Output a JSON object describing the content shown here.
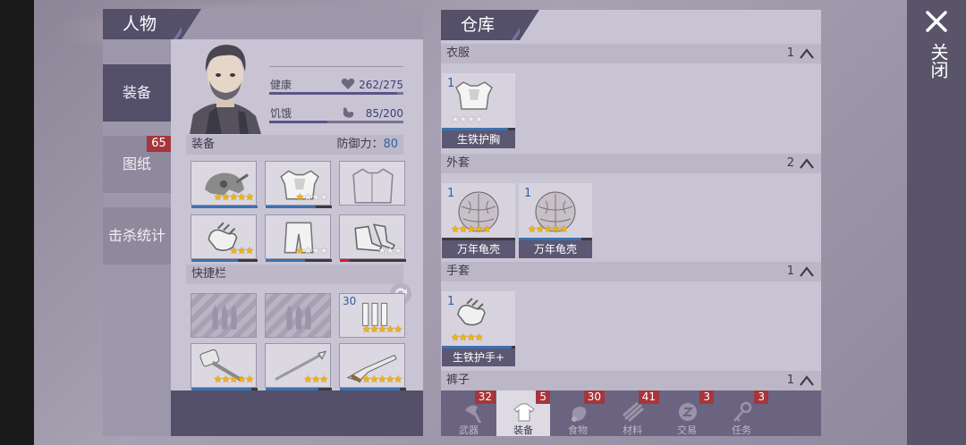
{
  "character": {
    "header": "人物",
    "tabs": [
      {
        "label": "装备",
        "active": true
      },
      {
        "label": "图纸",
        "badge": "65"
      },
      {
        "label": "击杀统计"
      }
    ],
    "stats": {
      "health_label": "健康",
      "health_value": "262/275",
      "health_fraction": 0.95,
      "hunger_label": "饥饿",
      "hunger_value": "85/200",
      "hunger_fraction": 0.43
    },
    "equipment": {
      "label": "装备",
      "defense_label": "防御力：",
      "defense_value": "80",
      "slots": [
        {
          "icon": "helmet-icon",
          "stars": 5,
          "quality_fraction": 1.0
        },
        {
          "icon": "chest-armor-icon",
          "stars": 4,
          "white_stars": 3,
          "quality_fraction": 0.75
        },
        {
          "icon": "coat-outline-icon",
          "stars": 0,
          "empty": true
        },
        {
          "icon": "gloves-icon",
          "stars": 3,
          "quality_fraction": 0.7
        },
        {
          "icon": "pants-icon",
          "stars": 4,
          "white_stars": 3,
          "quality_fraction": 0.6
        },
        {
          "icon": "boots-icon",
          "stars": 3,
          "white_stars": 3,
          "quality_fraction": 0.15,
          "quality_color": "#c4242b"
        }
      ]
    },
    "quickbar": {
      "label": "快捷栏",
      "slots": [
        {
          "icon": "ammo-empty-icon",
          "empty": true
        },
        {
          "icon": "ammo-empty-icon",
          "empty": true
        },
        {
          "icon": "ammo-icon",
          "count": "30",
          "stars": 5
        },
        {
          "icon": "sledgehammer-icon",
          "stars": 5,
          "quality_fraction": 0.9
        },
        {
          "icon": "spear-icon",
          "stars": 3,
          "quality_fraction": 0.8
        },
        {
          "icon": "shotgun-icon",
          "stars": 5,
          "quality_fraction": 0.9
        }
      ]
    }
  },
  "warehouse": {
    "header": "仓库",
    "categories": [
      {
        "label": "衣服",
        "count": "1",
        "items": [
          {
            "count": "1",
            "name": "生铁护胸",
            "stars": 4,
            "white_stars": 4,
            "icon": "chest-armor-icon",
            "quality_fraction": 0.9
          }
        ]
      },
      {
        "label": "外套",
        "count": "2",
        "items": [
          {
            "count": "1",
            "name": "万年龟壳",
            "stars": 5,
            "icon": "turtle-shell-icon",
            "quality_fraction": 0.0
          },
          {
            "count": "1",
            "name": "万年龟壳",
            "stars": 5,
            "icon": "turtle-shell-icon",
            "quality_fraction": 0.85
          }
        ]
      },
      {
        "label": "手套",
        "count": "1",
        "items": [
          {
            "count": "1",
            "name": "生铁护手+",
            "stars": 4,
            "icon": "gloves-icon",
            "quality_fraction": 0.95
          }
        ]
      },
      {
        "label": "裤子",
        "count": "1",
        "items": []
      }
    ],
    "bottom_tabs": [
      {
        "label": "武器",
        "badge": "32",
        "icon": "axe-icon"
      },
      {
        "label": "装备",
        "badge": "5",
        "icon": "shirt-icon",
        "active": true
      },
      {
        "label": "食物",
        "badge": "30",
        "icon": "meat-icon"
      },
      {
        "label": "材料",
        "badge": "41",
        "icon": "wood-icon"
      },
      {
        "label": "交易",
        "badge": "3",
        "icon": "coin-icon"
      },
      {
        "label": "任务",
        "badge": "3",
        "icon": "key-icon"
      }
    ]
  },
  "close_label": "关闭",
  "colors": {
    "panel_dark": "#54506a",
    "star": "#f2b318",
    "badge": "#a5363b",
    "quality_blue": "#3a72b0"
  }
}
